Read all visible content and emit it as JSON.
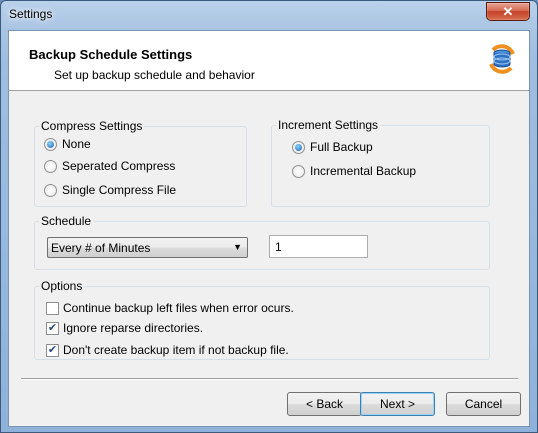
{
  "window": {
    "title": "Settings",
    "close_glyph": "✕"
  },
  "header": {
    "title": "Backup Schedule Settings",
    "subtitle": "Set up backup schedule and behavior",
    "icon": "backup-sync-icon"
  },
  "compress": {
    "legend": "Compress Settings",
    "options": [
      {
        "label": "None",
        "checked": true
      },
      {
        "label": "Seperated Compress",
        "checked": false
      },
      {
        "label": "Single Compress File",
        "checked": false
      }
    ]
  },
  "increment": {
    "legend": "Increment Settings",
    "options": [
      {
        "label": "Full Backup",
        "checked": true
      },
      {
        "label": "Incremental Backup",
        "checked": false
      }
    ]
  },
  "schedule": {
    "legend": "Schedule",
    "selected": "Every # of Minutes",
    "value": "1"
  },
  "options": {
    "legend": "Options",
    "items": [
      {
        "label": "Continue backup left files when error ocurs.",
        "checked": false
      },
      {
        "label": "Ignore reparse directories.",
        "checked": true
      },
      {
        "label": "Don't create backup item if not backup file.",
        "checked": true
      }
    ]
  },
  "buttons": {
    "back": "< Back",
    "next": "Next >",
    "cancel": "Cancel"
  }
}
